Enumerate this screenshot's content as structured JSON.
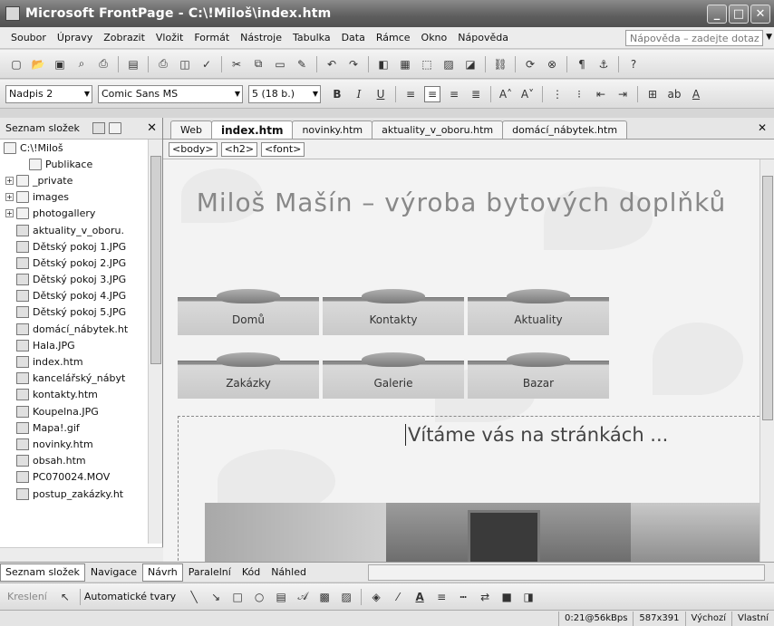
{
  "window": {
    "title": "Microsoft FrontPage - C:\\!Miloš\\index.htm"
  },
  "menubar": {
    "items": [
      "Soubor",
      "Úpravy",
      "Zobrazit",
      "Vložit",
      "Formát",
      "Nástroje",
      "Tabulka",
      "Data",
      "Rámce",
      "Okno",
      "Nápověda"
    ],
    "help_placeholder": "Nápověda – zadejte dotaz"
  },
  "format_toolbar": {
    "style": "Nadpis 2",
    "font": "Comic Sans MS",
    "size": "5 (18 b.)",
    "bold": "B",
    "italic": "I",
    "underline": "U"
  },
  "folder_pane": {
    "title": "Seznam složek",
    "root": "C:\\!Miloš",
    "items": [
      {
        "label": "Publikace",
        "type": "folder"
      },
      {
        "label": "_private",
        "type": "folder"
      },
      {
        "label": "images",
        "type": "folder"
      },
      {
        "label": "photogallery",
        "type": "folder"
      },
      {
        "label": "aktuality_v_oboru.",
        "type": "file"
      },
      {
        "label": "Dětský pokoj 1.JPG",
        "type": "file"
      },
      {
        "label": "Dětský pokoj 2.JPG",
        "type": "file"
      },
      {
        "label": "Dětský pokoj 3.JPG",
        "type": "file"
      },
      {
        "label": "Dětský pokoj 4.JPG",
        "type": "file"
      },
      {
        "label": "Dětský pokoj 5.JPG",
        "type": "file"
      },
      {
        "label": "domácí_nábytek.ht",
        "type": "file"
      },
      {
        "label": "Hala.JPG",
        "type": "file"
      },
      {
        "label": "index.htm",
        "type": "file"
      },
      {
        "label": "kancelářský_nábyt",
        "type": "file"
      },
      {
        "label": "kontakty.htm",
        "type": "file"
      },
      {
        "label": "Koupelna.JPG",
        "type": "file"
      },
      {
        "label": "Mapa!.gif",
        "type": "file"
      },
      {
        "label": "novinky.htm",
        "type": "file"
      },
      {
        "label": "obsah.htm",
        "type": "file"
      },
      {
        "label": "PC070024.MOV",
        "type": "file"
      },
      {
        "label": "postup_zakázky.ht",
        "type": "file"
      }
    ]
  },
  "editor": {
    "tabs": [
      "Web",
      "index.htm",
      "novinky.htm",
      "aktuality_v_oboru.htm",
      "domácí_nábytek.htm"
    ],
    "active_tab": "index.htm",
    "tags": [
      "<body>",
      "<h2>",
      "<font>"
    ],
    "page": {
      "title": "Miloš Mašín – výroba bytových doplňků",
      "nav_row1": [
        "Domů",
        "Kontakty",
        "Aktuality"
      ],
      "nav_row2": [
        "Zakázky",
        "Galerie",
        "Bazar"
      ],
      "welcome": "Vítáme vás na stránkách ..."
    }
  },
  "viewbar": {
    "folder_list": "Seznam složek",
    "navigation": "Navigace",
    "views": [
      "Návrh",
      "Paralelní",
      "Kód",
      "Náhled"
    ],
    "active_view": "Návrh"
  },
  "drawbar": {
    "drawing": "Kreslení",
    "autoshapes": "Automatické tvary"
  },
  "statusbar": {
    "download": "0:21@56kBps",
    "dimensions": "587x391",
    "style": "Výchozí",
    "custom": "Vlastní"
  }
}
